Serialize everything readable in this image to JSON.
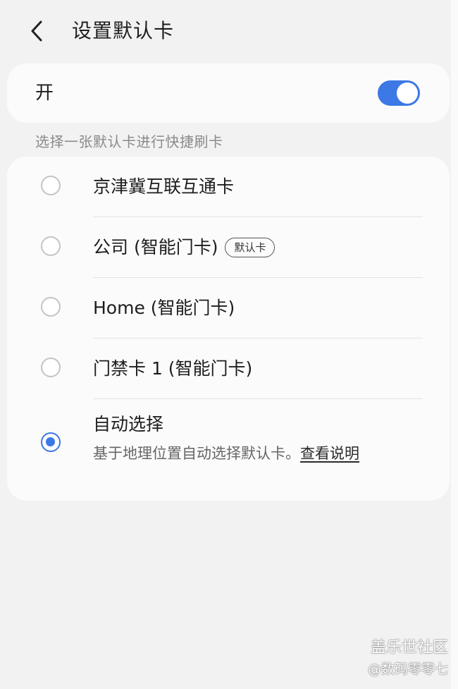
{
  "header": {
    "back_icon": "chevron-left-icon",
    "title": "设置默认卡"
  },
  "toggle": {
    "label": "开",
    "state": true,
    "accent_color": "#3c78e6"
  },
  "section_hint": "选择一张默认卡进行快捷刷卡",
  "cards": [
    {
      "label": "京津冀互联互通卡",
      "selected": false
    },
    {
      "label": "公司 (智能门卡)",
      "selected": false,
      "badge": "默认卡"
    },
    {
      "label": "Home (智能门卡)",
      "selected": false
    },
    {
      "label": "门禁卡 1 (智能门卡)",
      "selected": false
    }
  ],
  "auto_select": {
    "title": "自动选择",
    "description": "基于地理位置自动选择默认卡。",
    "link": "查看说明",
    "selected": true
  },
  "watermark": {
    "line1": "盖乐世社区",
    "line2": "@数码零零七"
  }
}
